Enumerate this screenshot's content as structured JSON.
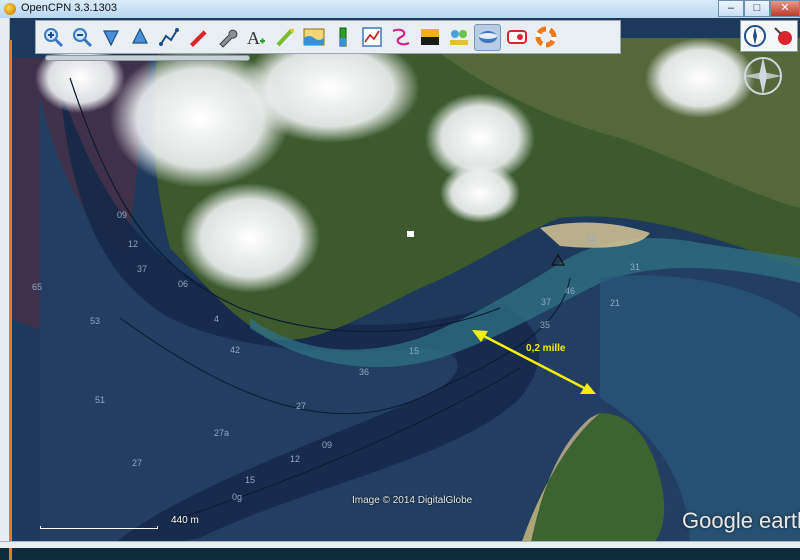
{
  "window": {
    "title": "OpenCPN 3.3.1303",
    "min_glyph": "–",
    "max_glyph": "□",
    "close_glyph": "✕"
  },
  "toolbar": {
    "tools": [
      {
        "name": "zoom-in-icon"
      },
      {
        "name": "zoom-out-icon"
      },
      {
        "name": "scale-down-icon"
      },
      {
        "name": "scale-up-icon"
      },
      {
        "name": "route-icon"
      },
      {
        "name": "auto-follow-icon"
      },
      {
        "name": "options-wrench-icon"
      },
      {
        "name": "text-icon"
      },
      {
        "name": "current-icon"
      },
      {
        "name": "tide-icon"
      },
      {
        "name": "tide-gauge-icon"
      },
      {
        "name": "route-manager-icon"
      },
      {
        "name": "track-icon"
      },
      {
        "name": "color-scheme-icon"
      },
      {
        "name": "ais-icon"
      },
      {
        "name": "google-earth-icon"
      },
      {
        "name": "man-overboard-icon"
      },
      {
        "name": "life-ring-icon"
      }
    ]
  },
  "chart": {
    "distance_label": "0,2 mille",
    "copyright": "Image © 2014 DigitalGlobe",
    "scale_label": "440  m",
    "watermark": "Google earth",
    "depths": [
      {
        "v": "65"
      },
      {
        "v": "53"
      },
      {
        "v": "51"
      },
      {
        "v": "42"
      },
      {
        "v": "27"
      },
      {
        "v": "27a"
      },
      {
        "v": "15"
      },
      {
        "v": "12"
      },
      {
        "v": "0g"
      },
      {
        "v": "37"
      },
      {
        "v": "31"
      },
      {
        "v": "46"
      },
      {
        "v": "37"
      },
      {
        "v": "35"
      },
      {
        "v": "09"
      },
      {
        "v": "12"
      },
      {
        "v": "15"
      },
      {
        "v": "06"
      },
      {
        "v": "21"
      },
      {
        "v": "4"
      },
      {
        "v": "09"
      },
      {
        "v": "27"
      },
      {
        "v": "36"
      },
      {
        "v": "21"
      }
    ]
  },
  "colors": {
    "accent": "#f5f000",
    "toolbar_bg": "#e9eef3",
    "deep_water": "#1d3a5c",
    "land": "#3c5a2c"
  }
}
